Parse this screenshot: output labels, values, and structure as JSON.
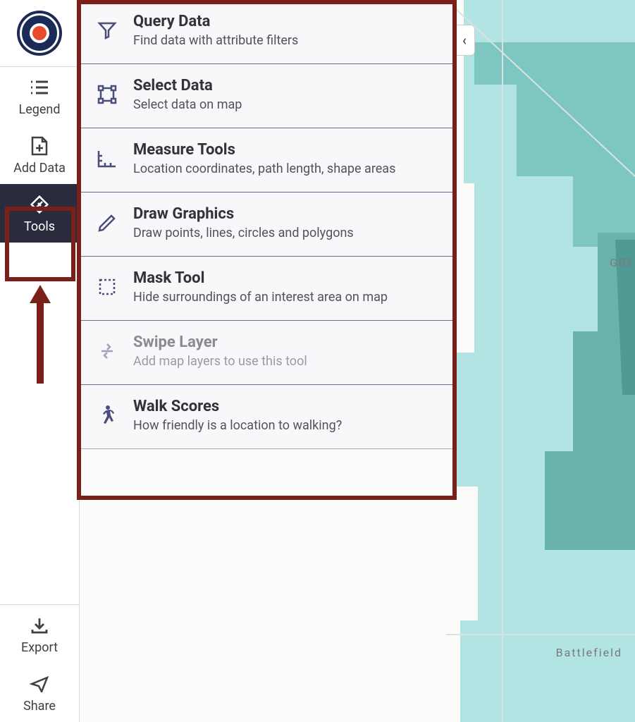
{
  "logo": {
    "alt": "Missouri CAN Community Action Network"
  },
  "sidebar": {
    "items": [
      {
        "label": "Legend"
      },
      {
        "label": "Add Data"
      },
      {
        "label": "Tools"
      }
    ],
    "bottom": [
      {
        "label": "Export"
      },
      {
        "label": "Share"
      }
    ]
  },
  "tools": [
    {
      "title": "Query Data",
      "desc": "Find data with attribute filters"
    },
    {
      "title": "Select Data",
      "desc": "Select data on map"
    },
    {
      "title": "Measure Tools",
      "desc": "Location coordinates, path length, shape areas"
    },
    {
      "title": "Draw Graphics",
      "desc": "Draw points, lines, circles and polygons"
    },
    {
      "title": "Mask Tool",
      "desc": "Hide surroundings of an interest area on map"
    },
    {
      "title": "Swipe Layer",
      "desc": "Add map layers to use this tool",
      "disabled": true
    },
    {
      "title": "Walk Scores",
      "desc": "How friendly is a location to walking?"
    }
  ],
  "map": {
    "labels": [
      {
        "text": "Battlefield"
      },
      {
        "text": "GRE"
      }
    ]
  },
  "collapse": {
    "glyph": "‹"
  }
}
